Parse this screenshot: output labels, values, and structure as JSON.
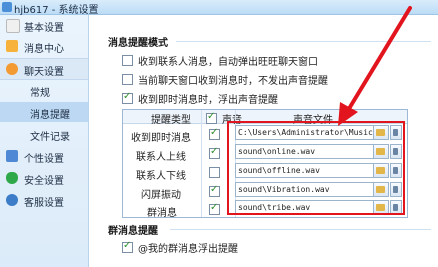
{
  "window": {
    "title": "hjb617 - 系统设置"
  },
  "sidebar": {
    "items": [
      {
        "label": "基本设置",
        "icon": "settings-icon"
      },
      {
        "label": "消息中心",
        "icon": "mail-icon"
      },
      {
        "label": "聊天设置",
        "icon": "chat-icon"
      },
      {
        "label": "常规"
      },
      {
        "label": "消息提醒"
      },
      {
        "label": "文件记录"
      },
      {
        "label": "个性设置",
        "icon": "personalize-icon"
      },
      {
        "label": "安全设置",
        "icon": "shield-icon"
      },
      {
        "label": "客服设置",
        "icon": "headset-icon"
      }
    ]
  },
  "message_alert": {
    "section_title": "消息提醒模式",
    "options": [
      {
        "label": "收到联系人消息，自动弹出旺旺聊天窗口",
        "checked": false
      },
      {
        "label": "当前聊天窗口收到消息时，不发出声音提醒",
        "checked": false
      },
      {
        "label": "收到即时消息时，浮出声音提醒",
        "checked": true
      }
    ]
  },
  "sound_table": {
    "headers": {
      "type": "提醒类型",
      "sound": "声音",
      "file": "声音文件"
    },
    "header_sound_checked": true,
    "rows": [
      {
        "type": "收到即时消息",
        "sound": true,
        "file": "C:\\Users\\Administrator\\Music\\"
      },
      {
        "type": "联系人上线",
        "sound": true,
        "file": "sound\\online.wav"
      },
      {
        "type": "联系人下线",
        "sound": false,
        "file": "sound\\offline.wav"
      },
      {
        "type": "闪屏振动",
        "sound": true,
        "file": "sound\\Vibration.wav"
      },
      {
        "type": "群消息",
        "sound": true,
        "file": "sound\\tribe.wav"
      }
    ]
  },
  "group_alert": {
    "section_title": "群消息提醒",
    "options": [
      {
        "label": "@我的群消息浮出提醒",
        "checked": true
      }
    ]
  },
  "colors": {
    "annotation": "#e2141d",
    "check": "#2f8f2f",
    "header_bg": "#eef4fb"
  }
}
